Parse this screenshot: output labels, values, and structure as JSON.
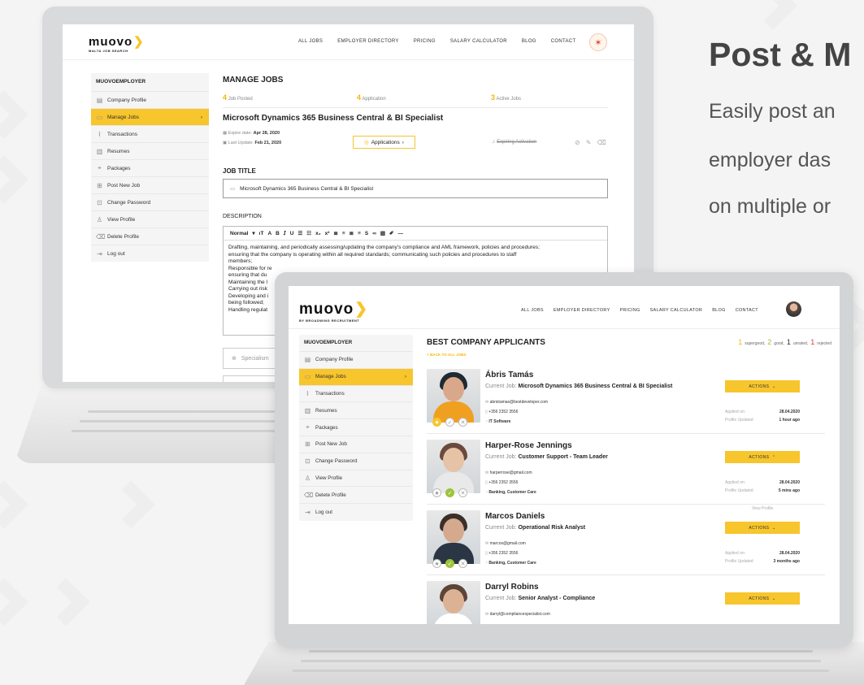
{
  "hero": {
    "title": "Post & M",
    "line1": "Easily post an",
    "line2": "employer das",
    "line3": "on multiple or"
  },
  "brand": {
    "logo": "muovo",
    "tagline_back": "MALTA JOB SEARCH",
    "tagline_front": "BY BROADWING RECRUITMENT",
    "accent": "#f7c52c"
  },
  "nav": [
    "ALL JOBS",
    "EMPLOYER DIRECTORY",
    "PRICING",
    "SALARY CALCULATOR",
    "BLOG",
    "CONTACT"
  ],
  "sidebar": {
    "heading": "MUOVOEMPLOYER",
    "items": [
      {
        "label": "Company Profile",
        "icon": "doc-icon"
      },
      {
        "label": "Manage Jobs",
        "icon": "briefcase-icon"
      },
      {
        "label": "Transactions",
        "icon": "chart-icon"
      },
      {
        "label": "Resumes",
        "icon": "file-icon"
      },
      {
        "label": "Packages",
        "icon": "tag-icon"
      },
      {
        "label": "Post New Job",
        "icon": "plus-icon"
      },
      {
        "label": "Change Password",
        "icon": "lock-icon"
      },
      {
        "label": "View Profile",
        "icon": "user-icon"
      },
      {
        "label": "Delete Profile",
        "icon": "trash-icon"
      },
      {
        "label": "Log out",
        "icon": "logout-icon"
      }
    ]
  },
  "manage": {
    "title": "MANAGE JOBS",
    "steps": [
      {
        "num": "4",
        "label": "Job Posted"
      },
      {
        "num": "4",
        "label": "Application"
      },
      {
        "num": "3",
        "label": "Active Jobs"
      }
    ],
    "job_title": "Microsoft Dynamics 365 Business Central & BI Specialist",
    "expire_label": "Expire date:",
    "expire_value": "Apr 28, 2020",
    "update_label": "Last Update:",
    "update_value": "Feb 21, 2020",
    "applications_btn": "Applications",
    "status": "Expiring Activation",
    "job_title_heading": "JOB TITLE",
    "job_title_value": "Microsoft Dynamics 365 Business Central & BI Specialist",
    "description_heading": "DESCRIPTION",
    "toolbar_style": "Normal",
    "description_lines": [
      "Drafting, maintaining, and periodically assessing/updating the company's compliance and AML framework, policies and procedures;",
      "ensuring that the company is operating within all required standards; communicating such policies and procedures to staff",
      "members;",
      "Responsible for re",
      "ensuring that du",
      "Maintaining the l",
      "Carrying out risk",
      "Developing and i",
      "being followed;",
      "Handling regulat"
    ],
    "specialism_placeholder": "Specialism"
  },
  "applicants": {
    "title": "BEST COMPANY APPLICANTS",
    "back": "< BACK TO ALL JOBS",
    "summary": [
      {
        "num": "1",
        "label": "supergood,",
        "color": "#f5b800"
      },
      {
        "num": "2",
        "label": "good,",
        "color": "#9dc33b"
      },
      {
        "num": "1",
        "label": "unrated,",
        "color": "#333333"
      },
      {
        "num": "1",
        "label": "rejected",
        "color": "#e53935"
      }
    ],
    "current_job_label": "Current Job:",
    "actions_label": "ACTIONS",
    "applied_label": "Applied on:",
    "updated_label": "Profile Updated:",
    "view_profile": "View Profile",
    "list": [
      {
        "name": "Ábris Tamás",
        "job": "Microsoft Dynamics 365 Business Central & BI Specialist",
        "email": "abristamas@bestdeveloper.com",
        "phone": "+356 2352 3556",
        "sector": "IT Software",
        "applied": "28.04.2020",
        "updated": "1 hour ago"
      },
      {
        "name": "Harper-Rose Jennings",
        "job": "Customer Support - Team Leader",
        "email": "harperrose@gmail.com",
        "phone": "+356 2352 3556",
        "sector": "Banking, Customer Care",
        "applied": "28.04.2020",
        "updated": "5 mins ago"
      },
      {
        "name": "Marcos Daniels",
        "job": "Operational Risk Analyst",
        "email": "marcos@gmail.com",
        "phone": "+356 2352 3556",
        "sector": "Banking, Customer Care",
        "applied": "28.04.2020",
        "updated": "3 months ago"
      },
      {
        "name": "Darryl Robins",
        "job": "Senior Analyst - Compliance",
        "email": "darryl@compliancespecialist.com"
      }
    ]
  }
}
